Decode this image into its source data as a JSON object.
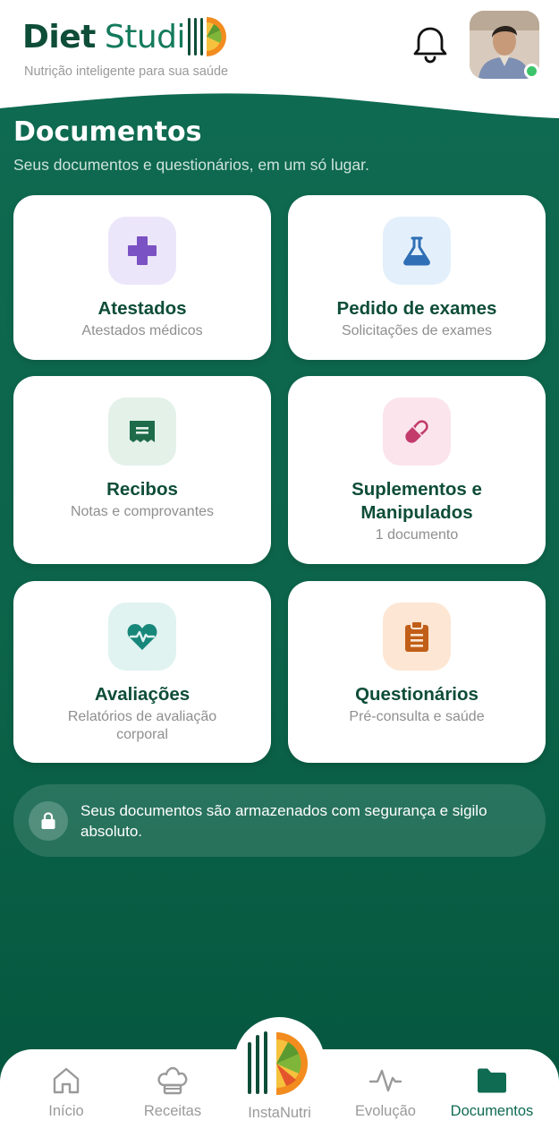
{
  "header": {
    "brand_part1": "Diet",
    "brand_part2": "Studi",
    "tagline": "Nutrição inteligente para sua saúde"
  },
  "page": {
    "title": "Documentos",
    "subtitle": "Seus documentos e questionários, em um só lugar."
  },
  "cards": [
    {
      "title": "Atestados",
      "subtitle": "Atestados médicos",
      "icon": "medical-cross-icon",
      "bg": "#ece6fa",
      "color": "#7a52c4"
    },
    {
      "title": "Pedido de exames",
      "subtitle": "Solicitações de exames",
      "icon": "flask-icon",
      "bg": "#e3f0fb",
      "color": "#2f6fb5"
    },
    {
      "title": "Recibos",
      "subtitle": "Notas e comprovantes",
      "icon": "receipt-icon",
      "bg": "#e3f1e9",
      "color": "#1e6b4a"
    },
    {
      "title": "Suplementos e Manipulados",
      "subtitle": "1 documento",
      "icon": "capsule-icon",
      "bg": "#fbe4ec",
      "color": "#c23b6b"
    },
    {
      "title": "Avaliações",
      "subtitle": "Relatórios de avaliação corporal",
      "icon": "heart-pulse-icon",
      "bg": "#e0f3f1",
      "color": "#17877a"
    },
    {
      "title": "Questionários",
      "subtitle": "Pré-consulta e saúde",
      "icon": "clipboard-icon",
      "bg": "#fde6d3",
      "color": "#c15f19"
    }
  ],
  "notice": {
    "text": "Seus documentos são armazenados com segurança e sigilo absoluto."
  },
  "nav": {
    "items": [
      {
        "label": "Início",
        "icon": "home-icon"
      },
      {
        "label": "Receitas",
        "icon": "chef-hat-icon"
      },
      {
        "label": "InstaNutri",
        "icon": "instanutri-logo-icon"
      },
      {
        "label": "Evolução",
        "icon": "activity-icon"
      },
      {
        "label": "Documentos",
        "icon": "folder-icon"
      }
    ],
    "active": "Documentos",
    "active_color": "#0f6b52"
  },
  "colors": {
    "brand_dark": "#0e4d38",
    "brand_green": "#137a5b",
    "background": "#0f6b52"
  }
}
